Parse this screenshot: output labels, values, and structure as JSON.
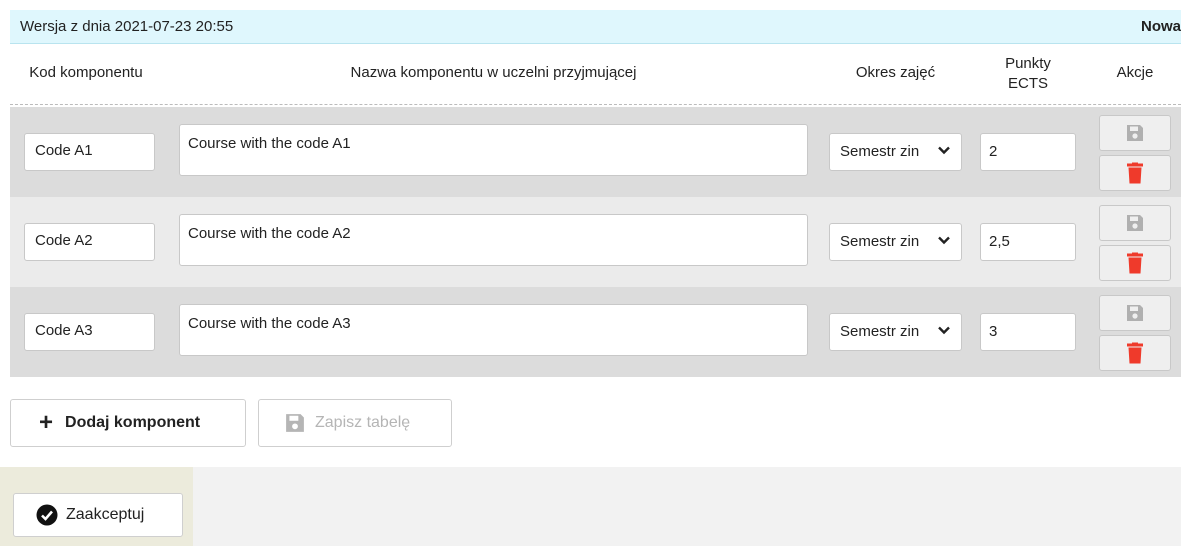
{
  "version": {
    "label": "Wersja z dnia 2021-07-23 20:55",
    "status": "Nowa"
  },
  "columns": {
    "code": "Kod komponentu",
    "name": "Nazwa komponentu w uczelni przyjmującej",
    "period": "Okres zajęć",
    "ects_line1": "Punkty",
    "ects_line2": "ECTS",
    "actions": "Akcje"
  },
  "rows": [
    {
      "code": "Code A1",
      "name": "Course with the code A1",
      "period": "Semestr zin",
      "ects": "2"
    },
    {
      "code": "Code A2",
      "name": "Course with the code A2",
      "period": "Semestr zin",
      "ects": "2,5"
    },
    {
      "code": "Code A3",
      "name": "Course with the code A3",
      "period": "Semestr zin",
      "ects": "3"
    }
  ],
  "buttons": {
    "add_component": "Dodaj komponent",
    "save_table": "Zapisz tabelę",
    "accept": "Zaakceptuj"
  },
  "icons": {
    "save": "floppy-disk-icon",
    "delete": "trash-icon",
    "dropdown": "chevron-down-icon",
    "add": "plus-icon",
    "accept": "check-circle-icon"
  },
  "colors": {
    "version_bar": "#dff7fd",
    "delete_icon": "#ef3a2b",
    "save_icon_disabled": "#b0b0b0"
  }
}
